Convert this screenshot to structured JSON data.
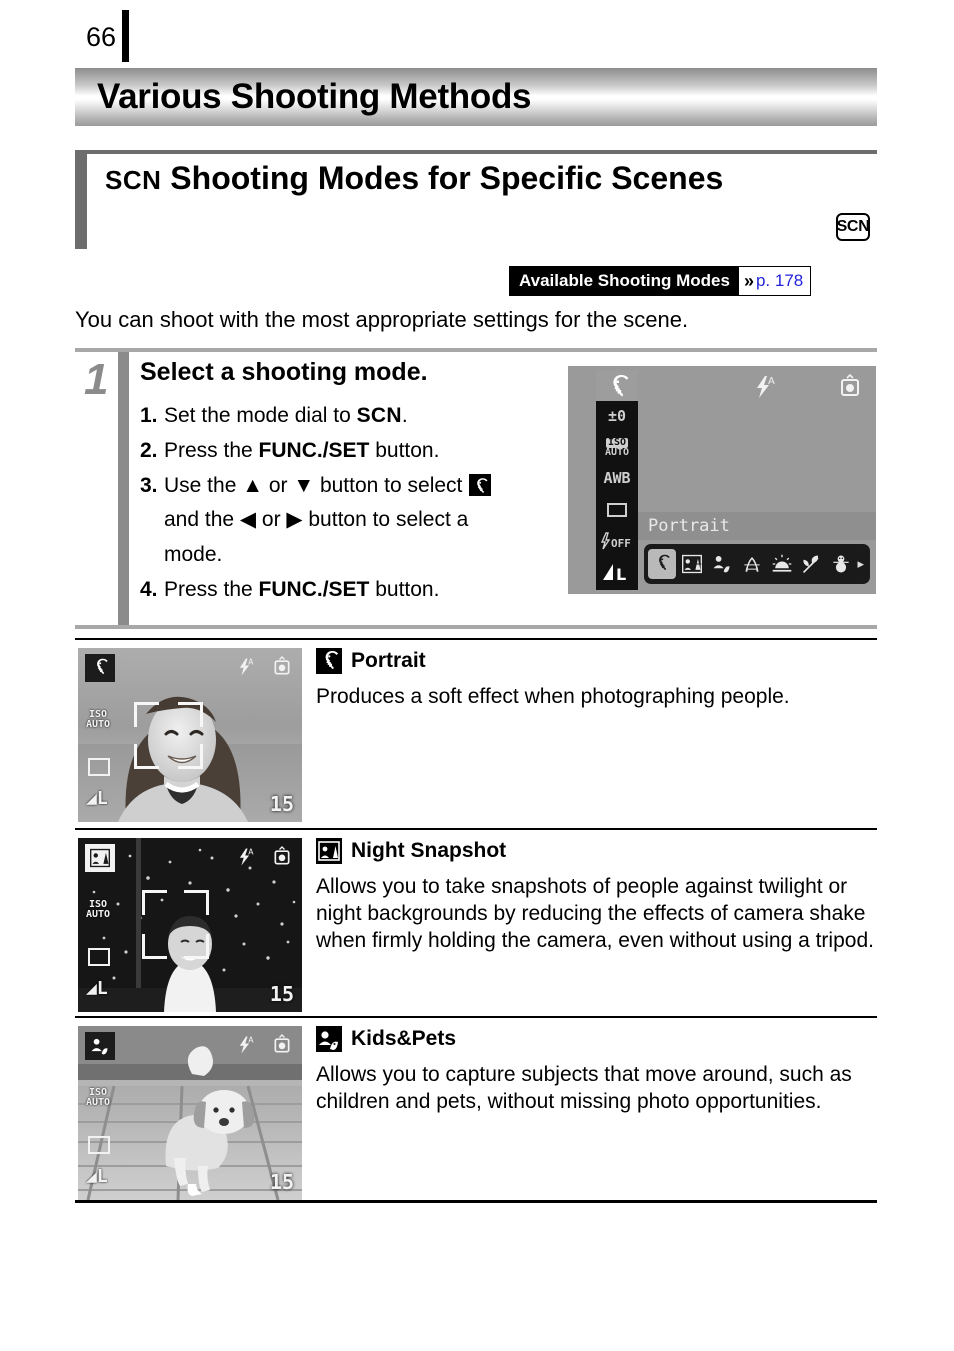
{
  "page": {
    "number": "66",
    "banner_title": "Various Shooting Methods",
    "bottom_rule": true
  },
  "section": {
    "prefix": "SCN",
    "title": "Shooting Modes for Specific Scenes",
    "mode_badge": "SCN",
    "available_badge": {
      "label": "Available Shooting Modes",
      "chevron": "chevron-double-right-icon",
      "page_link": "p. 178",
      "link_color": "#2222dd"
    },
    "intro": "You can shoot with the most appropriate settings for the scene."
  },
  "step": {
    "number": "1",
    "heading": "Select a shooting mode.",
    "items": [
      {
        "num": "1.",
        "pre": "Set the mode dial to ",
        "mono": "SCN",
        "post": "."
      },
      {
        "num": "2.",
        "pre": "Press the ",
        "bold": "FUNC./SET",
        "post": " button."
      },
      {
        "num": "3.",
        "pre": "Use the ▲ or ▼ button to select ",
        "post": ""
      },
      {
        "num": "4.",
        "pre": "Press the ",
        "bold": "FUNC./SET",
        "post": " button."
      }
    ],
    "item3_line2": "and the ◀ or ▶ button to select a",
    "item3_line3": "mode."
  },
  "lcd": {
    "sidebar": [
      {
        "name": "portrait-mode-icon",
        "text": "",
        "selected": true
      },
      {
        "name": "exposure-compensation",
        "text": "±0",
        "selected": false
      },
      {
        "name": "iso-setting",
        "text": "ISO",
        "sub": "AUTO",
        "selected": false
      },
      {
        "name": "white-balance",
        "text": "AWB",
        "selected": false
      },
      {
        "name": "drive-mode",
        "text": "",
        "selected": false
      },
      {
        "name": "flash-off",
        "text": "OFF",
        "selected": false
      },
      {
        "name": "image-quality",
        "text": "L",
        "selected": false
      }
    ],
    "top_icons": [
      "flash-auto-icon",
      "camera-shake-warning-icon"
    ],
    "mode_label": "Portrait",
    "mode_icons": [
      "portrait-icon",
      "night-snapshot-icon",
      "kids-pets-icon",
      "indoor-icon",
      "sunset-icon",
      "foliage-icon",
      "snow-icon"
    ],
    "selected_mode_index": 0,
    "scroll_arrow": "▸"
  },
  "modes": [
    {
      "id": "portrait",
      "icon": "portrait-icon",
      "title": "Portrait",
      "description": "Produces a soft effect when photographing people.",
      "thumbnail": {
        "scene": "smiling-woman-outdoors",
        "overlay_icon": "portrait-icon",
        "iso": "ISO AUTO",
        "quality": "L",
        "shots_remaining": "15",
        "flash": "flash-auto-icon",
        "warning": "camera-shake-warning-icon",
        "af_frame": true
      }
    },
    {
      "id": "night-snapshot",
      "icon": "night-snapshot-icon",
      "title": "Night Snapshot",
      "description": "Allows you to take snapshots of people against twilight or night backgrounds by reducing the effects of camera shake when firmly holding the camera, even without using a tripod.",
      "thumbnail": {
        "scene": "woman-in-front-of-lit-trees-at-night",
        "overlay_icon": "night-snapshot-icon",
        "iso": "ISO AUTO",
        "quality": "L",
        "shots_remaining": "15",
        "flash": "flash-auto-icon",
        "warning": "camera-shake-warning-icon",
        "af_frame": true
      }
    },
    {
      "id": "kids-pets",
      "icon": "kids-pets-icon",
      "title": "Kids&Pets",
      "description": "Allows you to capture subjects that move around, such as children and pets, without missing photo opportunities.",
      "thumbnail": {
        "scene": "small-dog-walking-on-deck",
        "overlay_icon": "kids-pets-icon",
        "iso": "ISO AUTO",
        "quality": "L",
        "shots_remaining": "15",
        "flash": "flash-auto-icon",
        "warning": "camera-shake-warning-icon",
        "af_frame": false
      }
    }
  ]
}
